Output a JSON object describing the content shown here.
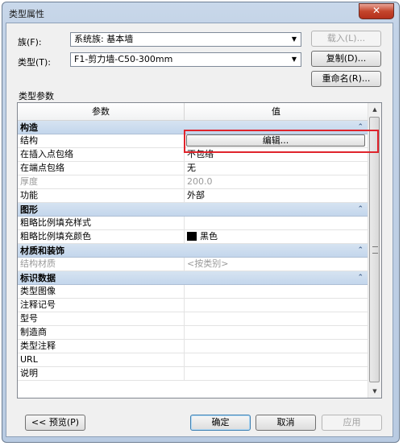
{
  "window": {
    "title": "类型属性",
    "close_glyph": "✕"
  },
  "family": {
    "label": "族(F):",
    "value": "系统族: 基本墙",
    "load_button": "载入(L)..."
  },
  "type": {
    "label": "类型(T):",
    "value": "F1-剪力墙-C50-300mm",
    "duplicate_button": "复制(D)...",
    "rename_button": "重命名(R)..."
  },
  "type_params_label": "类型参数",
  "table": {
    "col_param": "参数",
    "col_value": "值",
    "groups": [
      {
        "name": "构造",
        "rows": [
          {
            "param": "结构",
            "value": "编辑...",
            "kind": "button"
          },
          {
            "param": "在插入点包络",
            "value": "不包络"
          },
          {
            "param": "在端点包络",
            "value": "无"
          },
          {
            "param": "厚度",
            "value": "200.0",
            "gray": true
          },
          {
            "param": "功能",
            "value": "外部"
          }
        ]
      },
      {
        "name": "图形",
        "rows": [
          {
            "param": "粗略比例填充样式",
            "value": ""
          },
          {
            "param": "粗略比例填充颜色",
            "value": "黑色",
            "swatch": "#000000"
          }
        ]
      },
      {
        "name": "材质和装饰",
        "rows": [
          {
            "param": "结构材质",
            "value": "<按类别>",
            "gray": true
          }
        ]
      },
      {
        "name": "标识数据",
        "rows": [
          {
            "param": "类型图像",
            "value": ""
          },
          {
            "param": "注释记号",
            "value": ""
          },
          {
            "param": "型号",
            "value": ""
          },
          {
            "param": "制造商",
            "value": ""
          },
          {
            "param": "类型注释",
            "value": ""
          },
          {
            "param": "URL",
            "value": ""
          },
          {
            "param": "说明",
            "value": ""
          }
        ]
      }
    ]
  },
  "footer": {
    "preview_button": "<< 预览(P)",
    "ok_button": "确定",
    "cancel_button": "取消",
    "apply_button": "应用"
  },
  "colors": {
    "highlight": "#e0242c",
    "group_header": "#c3d6ec"
  }
}
